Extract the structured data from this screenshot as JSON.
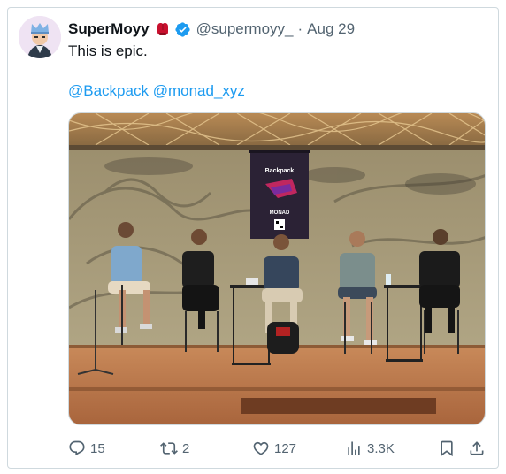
{
  "tweet": {
    "author": {
      "name": "SuperMoyy",
      "handle": "@supermoyy_",
      "date": "Aug 29",
      "separator": "·"
    },
    "text": "This is epic.",
    "mentions": [
      "@Backpack",
      "@monad_xyz"
    ],
    "media": {
      "banner_top": "Backpack",
      "banner_bottom": "MONAD"
    },
    "actions": {
      "replies": "15",
      "retweets": "2",
      "likes": "127",
      "views": "3.3K"
    }
  },
  "colors": {
    "link": "#1d9bf0",
    "verified": "#1d9bf0",
    "muted": "#536471"
  }
}
